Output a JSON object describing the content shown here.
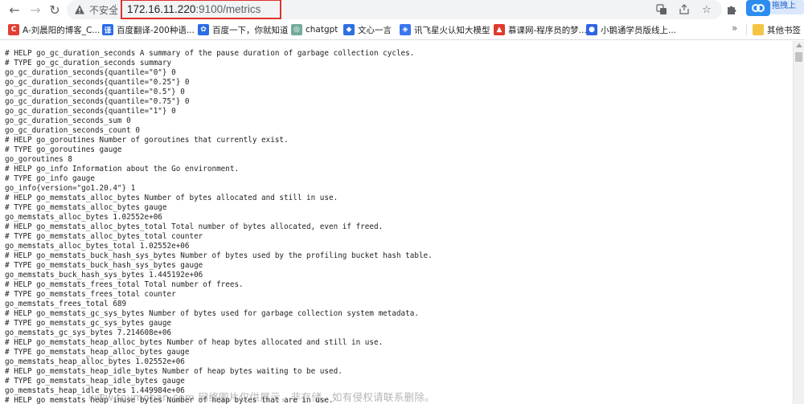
{
  "toolbar": {
    "security_label": "不安全",
    "url_host": "172.16.11.220",
    "url_rest": ":9100/metrics",
    "extension_badge": "拖拽上"
  },
  "bookmarks": [
    {
      "label": "A-刘晨阳的博客_C...",
      "icon": "csdn-icon",
      "color": "#e33e33",
      "glyph": "C"
    },
    {
      "label": "百度翻译-200种语...",
      "icon": "translate-icon",
      "color": "#2b6de6",
      "glyph": "译"
    },
    {
      "label": "百度一下，你就知道",
      "icon": "baidu-paw-icon",
      "color": "#2b6de6",
      "glyph": "✿"
    },
    {
      "label": "chatgpt",
      "icon": "chatgpt-icon",
      "color": "#74aa9c",
      "glyph": "◎"
    },
    {
      "label": "文心一言",
      "icon": "wenxin-icon",
      "color": "#2f6fe0",
      "glyph": "◆"
    },
    {
      "label": "讯飞星火认知大模型",
      "icon": "xunfei-icon",
      "color": "#3a76f0",
      "glyph": "◈"
    },
    {
      "label": "慕课网-程序员的梦...",
      "icon": "imooc-icon",
      "color": "#e0392b",
      "glyph": "▲"
    },
    {
      "label": "小鹅通学员版线上...",
      "icon": "xiaoetong-icon",
      "color": "#2f66e0",
      "glyph": "●"
    }
  ],
  "bookmarks_more": "»",
  "other_bookmarks": "其他书签",
  "metrics_lines": [
    "# HELP go_gc_duration_seconds A summary of the pause duration of garbage collection cycles.",
    "# TYPE go_gc_duration_seconds summary",
    "go_gc_duration_seconds{quantile=\"0\"} 0",
    "go_gc_duration_seconds{quantile=\"0.25\"} 0",
    "go_gc_duration_seconds{quantile=\"0.5\"} 0",
    "go_gc_duration_seconds{quantile=\"0.75\"} 0",
    "go_gc_duration_seconds{quantile=\"1\"} 0",
    "go_gc_duration_seconds_sum 0",
    "go_gc_duration_seconds_count 0",
    "# HELP go_goroutines Number of goroutines that currently exist.",
    "# TYPE go_goroutines gauge",
    "go_goroutines 8",
    "# HELP go_info Information about the Go environment.",
    "# TYPE go_info gauge",
    "go_info{version=\"go1.20.4\"} 1",
    "# HELP go_memstats_alloc_bytes Number of bytes allocated and still in use.",
    "# TYPE go_memstats_alloc_bytes gauge",
    "go_memstats_alloc_bytes 1.02552e+06",
    "# HELP go_memstats_alloc_bytes_total Total number of bytes allocated, even if freed.",
    "# TYPE go_memstats_alloc_bytes_total counter",
    "go_memstats_alloc_bytes_total 1.02552e+06",
    "# HELP go_memstats_buck_hash_sys_bytes Number of bytes used by the profiling bucket hash table.",
    "# TYPE go_memstats_buck_hash_sys_bytes gauge",
    "go_memstats_buck_hash_sys_bytes 1.445192e+06",
    "# HELP go_memstats_frees_total Total number of frees.",
    "# TYPE go_memstats_frees_total counter",
    "go_memstats_frees_total 689",
    "# HELP go_memstats_gc_sys_bytes Number of bytes used for garbage collection system metadata.",
    "# TYPE go_memstats_gc_sys_bytes gauge",
    "go_memstats_gc_sys_bytes 7.214608e+06",
    "# HELP go_memstats_heap_alloc_bytes Number of heap bytes allocated and still in use.",
    "# TYPE go_memstats_heap_alloc_bytes gauge",
    "go_memstats_heap_alloc_bytes 1.02552e+06",
    "# HELP go_memstats_heap_idle_bytes Number of heap bytes waiting to be used.",
    "# TYPE go_memstats_heap_idle_bytes gauge",
    "go_memstats_heap_idle_bytes 1.449984e+06",
    "# HELP go_memstats_heap_inuse_bytes Number of heap bytes that are in use."
  ],
  "watermark": "www.toymoban.com 网络图片仅供展示，非存储，如有侵权请联系删除。",
  "colors": {
    "omnibox_bg": "#f1f3f4",
    "url_highlight_border": "#e0312b",
    "extension_badge_bg": "#2d8cf0"
  }
}
